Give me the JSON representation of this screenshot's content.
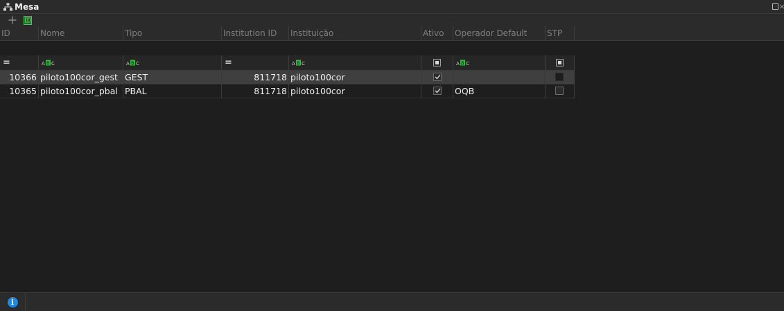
{
  "window": {
    "title": "Mesa",
    "title_icon": "hierarchy-icon",
    "controls": [
      "maximize-icon",
      "close-icon"
    ]
  },
  "toolbar": {
    "buttons": [
      {
        "name": "add-button",
        "icon": "plus-icon"
      },
      {
        "name": "export-button",
        "icon": "export-sheet-icon"
      }
    ]
  },
  "table": {
    "columns": [
      {
        "key": "id",
        "label": "ID",
        "filter": "equals"
      },
      {
        "key": "nome",
        "label": "Nome",
        "filter": "text"
      },
      {
        "key": "tipo",
        "label": "Tipo",
        "filter": "text"
      },
      {
        "key": "institution_id",
        "label": "Institution ID",
        "filter": "equals"
      },
      {
        "key": "instituicao",
        "label": "Instituição",
        "filter": "text"
      },
      {
        "key": "ativo",
        "label": "Ativo",
        "filter": "checkbox"
      },
      {
        "key": "operador_default",
        "label": "Operador Default",
        "filter": "text"
      },
      {
        "key": "stp",
        "label": "STP",
        "filter": "checkbox"
      }
    ],
    "rows": [
      {
        "id": "10366",
        "nome": "piloto100cor_gest",
        "tipo": "GEST",
        "institution_id": "811718",
        "instituicao": "piloto100cor",
        "ativo": true,
        "operador_default": "",
        "stp": false,
        "selected": true
      },
      {
        "id": "10365",
        "nome": "piloto100cor_pbal",
        "tipo": "PBAL",
        "institution_id": "811718",
        "instituicao": "piloto100cor",
        "ativo": true,
        "operador_default": "OQB",
        "stp": false,
        "selected": false
      }
    ]
  },
  "statusbar": {
    "icon": "info-icon",
    "icon_glyph": "i"
  },
  "colors": {
    "background": "#1e1e1e",
    "panel": "#2b2b2b",
    "selected_row": "#3f3f3f",
    "info": "#1e88e5",
    "abc_green": "#2fbf3a"
  }
}
